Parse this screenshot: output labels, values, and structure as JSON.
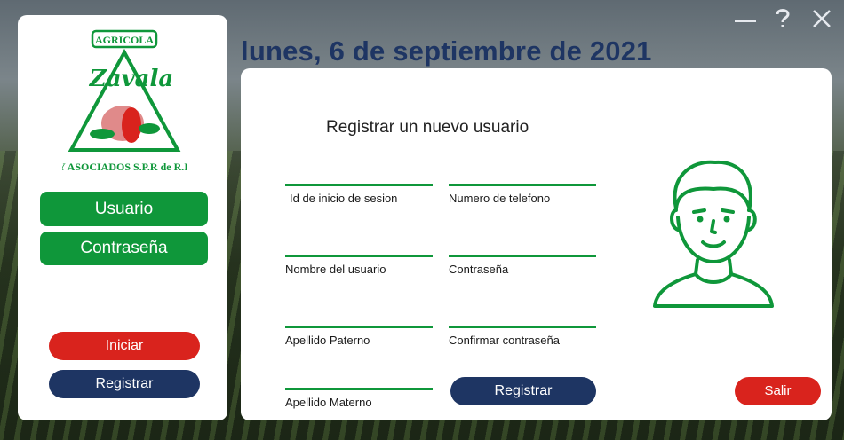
{
  "window": {
    "minimize_icon": "minimize-icon",
    "help_icon": "help-icon",
    "close_icon": "close-icon"
  },
  "logo": {
    "top_text": "AGRICOLA",
    "name_text": "Zavala",
    "bottom_text": "Y ASOCIADOS S.P.R de R.I."
  },
  "sidebar": {
    "user_label": "Usuario",
    "password_label": "Contraseña",
    "login_button": "Iniciar",
    "register_button": "Registrar"
  },
  "header": {
    "date": "lunes, 6 de septiembre de 2021"
  },
  "form": {
    "title": "Registrar un nuevo usuario",
    "fields": {
      "login_id": "Id de inicio de sesion",
      "phone": "Numero de telefono",
      "user_name": "Nombre del usuario",
      "password": "Contraseña",
      "last_name_paternal": "Apellido Paterno",
      "confirm_password": "Confirmar contraseña",
      "last_name_maternal": "Apellido Materno"
    },
    "register_button": "Registrar",
    "exit_button": "Salir"
  },
  "colors": {
    "green": "#0f973a",
    "red": "#d9231d",
    "navy": "#1e3563"
  }
}
